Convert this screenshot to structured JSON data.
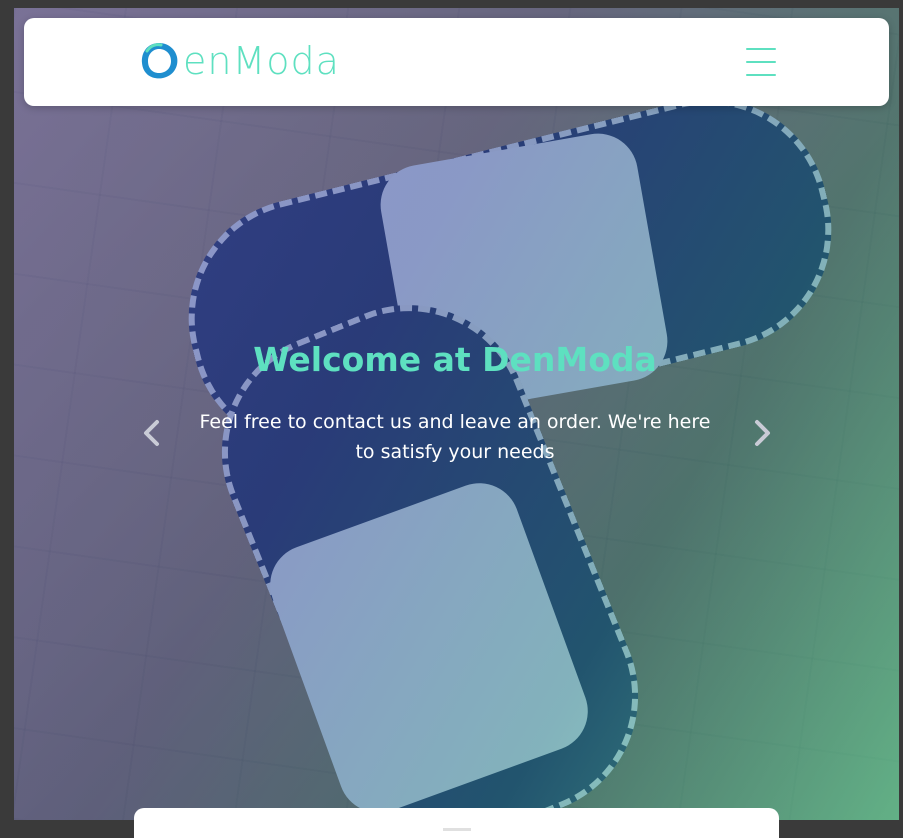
{
  "navbar": {
    "brand_text": "enModa",
    "menu_icon": "hamburger-icon"
  },
  "hero": {
    "title": "Welcome at DenModa",
    "subtitle": "Feel free to contact us and leave an order. We're here to satisfy your needs",
    "prev_icon": "chevron-left-icon",
    "next_icon": "chevron-right-icon"
  },
  "colors": {
    "accent": "#5ee0c0",
    "logo_blue": "#1f8ecf",
    "navbar_bg": "#ffffff"
  }
}
